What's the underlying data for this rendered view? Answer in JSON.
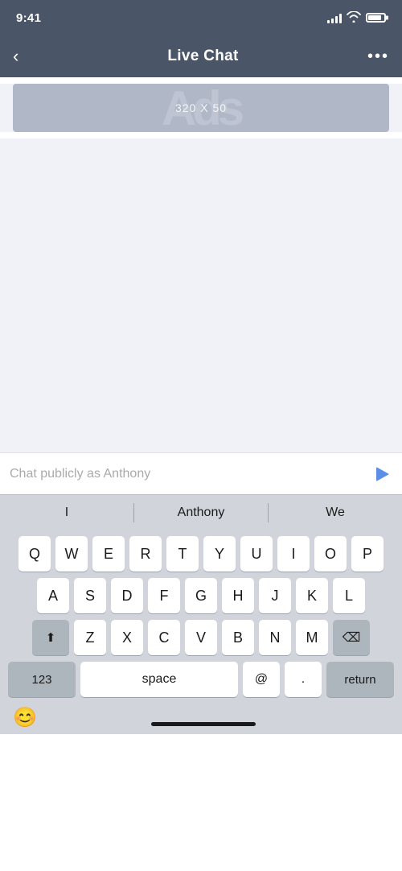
{
  "statusBar": {
    "time": "9:41",
    "locationIcon": "◂",
    "wifiLabel": "wifi",
    "batteryLabel": "battery"
  },
  "navBar": {
    "backLabel": "‹",
    "title": "Live Chat",
    "moreLabel": "•••"
  },
  "adBanner": {
    "text": "320 X 50",
    "watermark": "Ads"
  },
  "chatInput": {
    "placeholder": "Chat publicly as Anthony",
    "sendLabel": "send"
  },
  "autocomplete": {
    "items": [
      "I",
      "Anthony",
      "We"
    ]
  },
  "keyboard": {
    "row1": [
      "Q",
      "W",
      "E",
      "R",
      "T",
      "Y",
      "U",
      "I",
      "O",
      "P"
    ],
    "row2": [
      "A",
      "S",
      "D",
      "F",
      "G",
      "H",
      "J",
      "K",
      "L"
    ],
    "row3": [
      "Z",
      "X",
      "C",
      "V",
      "B",
      "N",
      "M"
    ],
    "shiftLabel": "⬆",
    "deleteLabel": "⌫",
    "numbersLabel": "123",
    "spaceLabel": "space",
    "atLabel": "@",
    "periodLabel": ".",
    "returnLabel": "return"
  },
  "bottomBar": {
    "emojiLabel": "😊"
  }
}
